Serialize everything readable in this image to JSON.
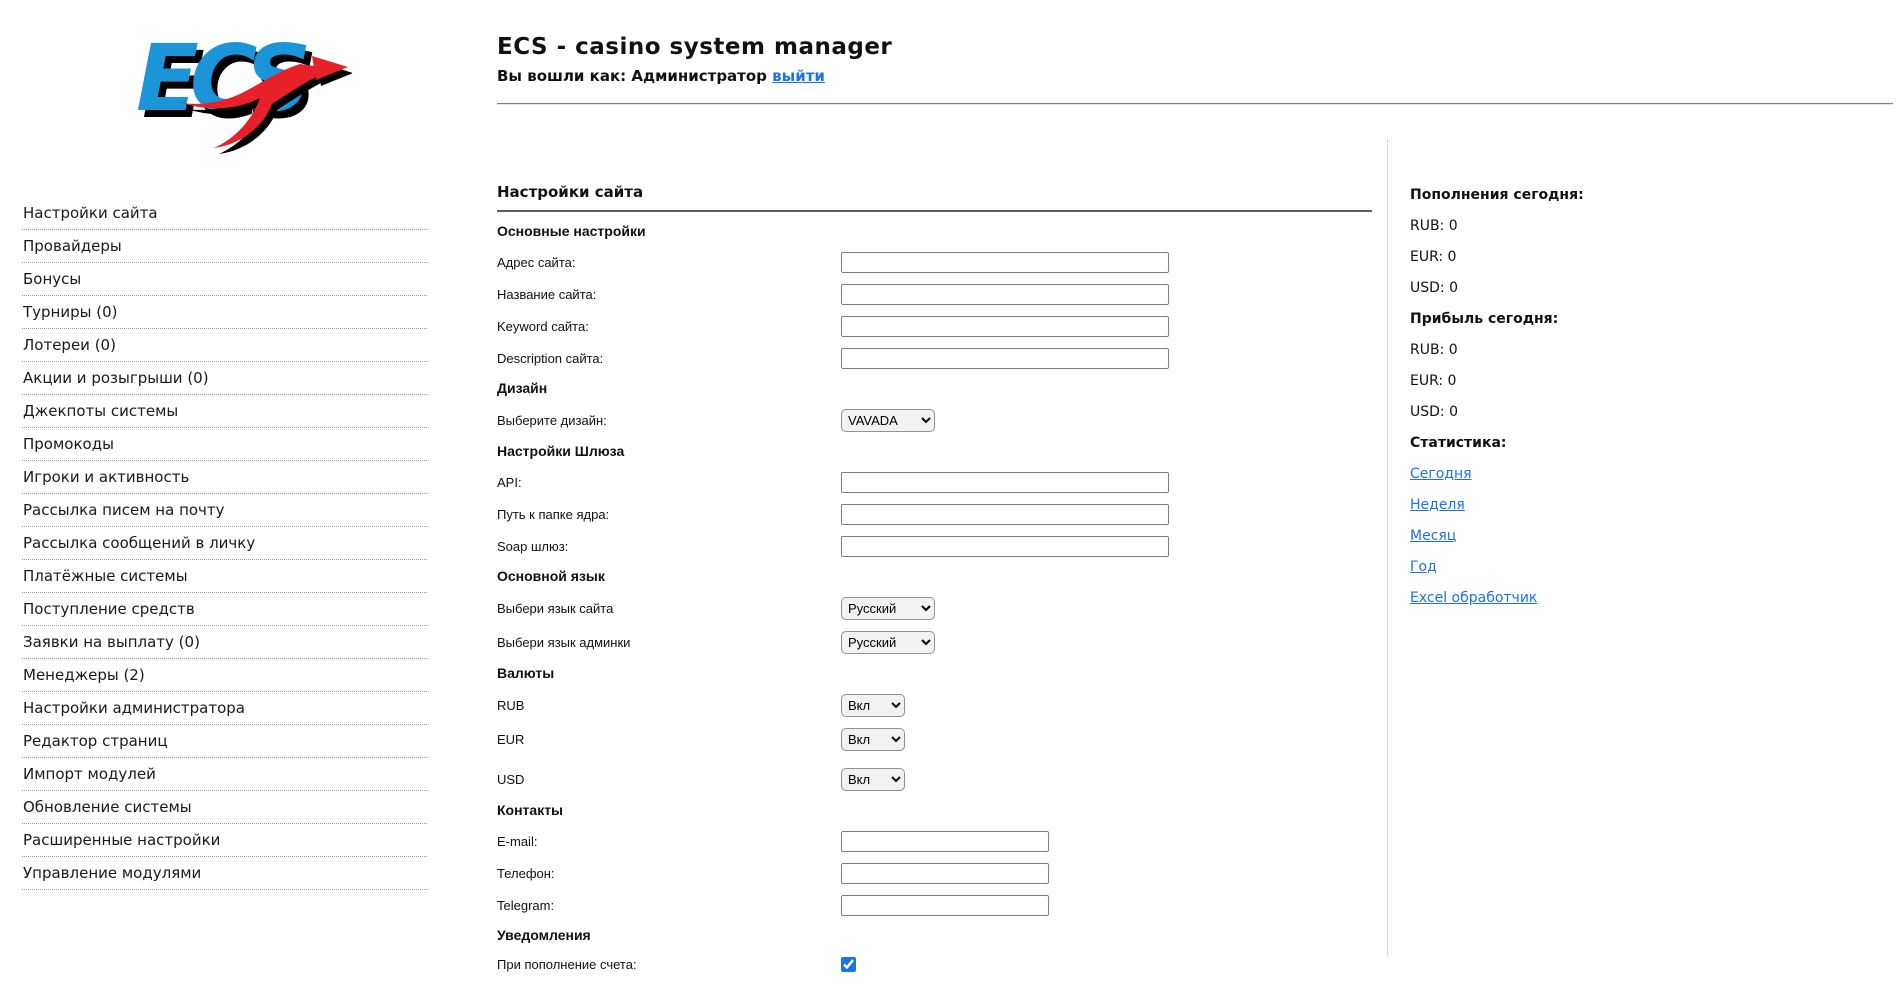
{
  "header": {
    "title": "ECS - casino system manager",
    "login_prefix": "Вы вошли как: Администратор",
    "logout_label": "выйти",
    "logo_text": "ECS"
  },
  "colors": {
    "logo_blue": "#1b95d8",
    "logo_red": "#e62129",
    "link_blue": "#1a73e8",
    "checkbox_blue": "#1a73e8"
  },
  "sidebar": {
    "items": [
      {
        "name": "site-settings",
        "label": "Настройки сайта"
      },
      {
        "name": "providers",
        "label": "Провайдеры"
      },
      {
        "name": "bonuses",
        "label": "Бонусы"
      },
      {
        "name": "tournaments",
        "label": "Турниры (0)"
      },
      {
        "name": "lotteries",
        "label": "Лотереи (0)"
      },
      {
        "name": "promotions",
        "label": "Акции и розыгрыши (0)"
      },
      {
        "name": "system-jackpots",
        "label": "Джекпоты системы"
      },
      {
        "name": "promocodes",
        "label": "Промокоды"
      },
      {
        "name": "players-activity",
        "label": "Игроки и активность"
      },
      {
        "name": "email-mailing",
        "label": "Рассылка писем на почту"
      },
      {
        "name": "pm-mailing",
        "label": "Рассылка сообщений в личку"
      },
      {
        "name": "payment-systems",
        "label": "Платёжные системы"
      },
      {
        "name": "incoming-funds",
        "label": "Поступление средств"
      },
      {
        "name": "payout-requests",
        "label": "Заявки на выплату (0)"
      },
      {
        "name": "managers",
        "label": "Менеджеры (2)"
      },
      {
        "name": "admin-settings",
        "label": "Настройки администратора"
      },
      {
        "name": "page-editor",
        "label": "Редактор страниц"
      },
      {
        "name": "module-import",
        "label": "Импорт модулей"
      },
      {
        "name": "system-update",
        "label": "Обновление системы"
      },
      {
        "name": "advanced-settings",
        "label": "Расширенные настройки"
      },
      {
        "name": "module-management",
        "label": "Управление модулями"
      }
    ]
  },
  "main": {
    "title": "Настройки сайта",
    "rows": [
      {
        "type": "section",
        "name": "basic-settings",
        "label": "Основные настройки"
      },
      {
        "type": "input",
        "name": "site-address",
        "label": "Адрес сайта:",
        "value": "",
        "size": "wide"
      },
      {
        "type": "input",
        "name": "site-name",
        "label": "Название сайта:",
        "value": "",
        "size": "wide"
      },
      {
        "type": "input",
        "name": "site-keyword",
        "label": "Keyword сайта:",
        "value": "",
        "size": "wide"
      },
      {
        "type": "input",
        "name": "site-description",
        "label": "Description сайта:",
        "value": "",
        "size": "wide"
      },
      {
        "type": "section",
        "name": "design",
        "label": "Дизайн"
      },
      {
        "type": "select",
        "name": "design",
        "label": "Выберите дизайн:",
        "value": "VAVADA",
        "width": "md"
      },
      {
        "type": "section",
        "name": "gateway-settings",
        "label": "Настройки Шлюза"
      },
      {
        "type": "input",
        "name": "api",
        "label": "API:",
        "value": "",
        "size": "wide"
      },
      {
        "type": "input",
        "name": "core-folder-path",
        "label": "Путь к папке ядра:",
        "value": "",
        "size": "wide"
      },
      {
        "type": "input",
        "name": "soap-gateway",
        "label": "Soap шлюз:",
        "value": "",
        "size": "wide"
      },
      {
        "type": "section",
        "name": "main-language",
        "label": "Основной язык"
      },
      {
        "type": "select",
        "name": "site-language",
        "label": "Выбери язык сайта",
        "value": "Русский",
        "width": "md"
      },
      {
        "type": "select",
        "name": "admin-language",
        "label": "Выбери язык админки",
        "value": "Русский",
        "width": "md"
      },
      {
        "type": "section",
        "name": "currencies",
        "label": "Валюты"
      },
      {
        "type": "select",
        "name": "rub-currency",
        "label": "RUB",
        "value": "Вкл",
        "width": "sm"
      },
      {
        "type": "select",
        "name": "eur-currency",
        "label": "EUR",
        "value": "Вкл",
        "width": "sm"
      },
      {
        "type": "select",
        "name": "usd-currency",
        "label": "USD",
        "value": "Вкл",
        "width": "sm",
        "gap_before": true
      },
      {
        "type": "section",
        "name": "contacts",
        "label": "Контакты"
      },
      {
        "type": "input",
        "name": "email",
        "label": "E-mail:",
        "value": "",
        "size": "narrow"
      },
      {
        "type": "input",
        "name": "phone",
        "label": "Телефон:",
        "value": "",
        "size": "narrow"
      },
      {
        "type": "input",
        "name": "telegram",
        "label": "Telegram:",
        "value": "",
        "size": "narrow"
      },
      {
        "type": "section",
        "name": "notifications",
        "label": "Уведомления"
      },
      {
        "type": "checkbox",
        "name": "deposit-notification",
        "label": "При пополнение счета:",
        "checked": true
      }
    ]
  },
  "right_panel": {
    "blocks": [
      {
        "type": "header",
        "name": "deposits-today-header",
        "text": "Пополнения сегодня:"
      },
      {
        "type": "text",
        "name": "deposits-rub",
        "text": "RUB: 0"
      },
      {
        "type": "text",
        "name": "deposits-eur",
        "text": "EUR: 0"
      },
      {
        "type": "text",
        "name": "deposits-usd",
        "text": "USD: 0"
      },
      {
        "type": "header",
        "name": "profit-today-header",
        "text": "Прибыль сегодня:"
      },
      {
        "type": "text",
        "name": "profit-rub",
        "text": "RUB: 0"
      },
      {
        "type": "text",
        "name": "profit-eur",
        "text": "EUR: 0"
      },
      {
        "type": "text",
        "name": "profit-usd",
        "text": "USD: 0"
      },
      {
        "type": "header",
        "name": "statistics-header",
        "text": "Статистика:"
      },
      {
        "type": "link",
        "name": "stats-link-today",
        "text": "Сегодня"
      },
      {
        "type": "link",
        "name": "stats-link-week",
        "text": "Неделя"
      },
      {
        "type": "link",
        "name": "stats-link-month",
        "text": "Месяц"
      },
      {
        "type": "link",
        "name": "stats-link-year",
        "text": "Год"
      },
      {
        "type": "link",
        "name": "stats-link-excel",
        "text": "Excel обработчик"
      }
    ]
  }
}
